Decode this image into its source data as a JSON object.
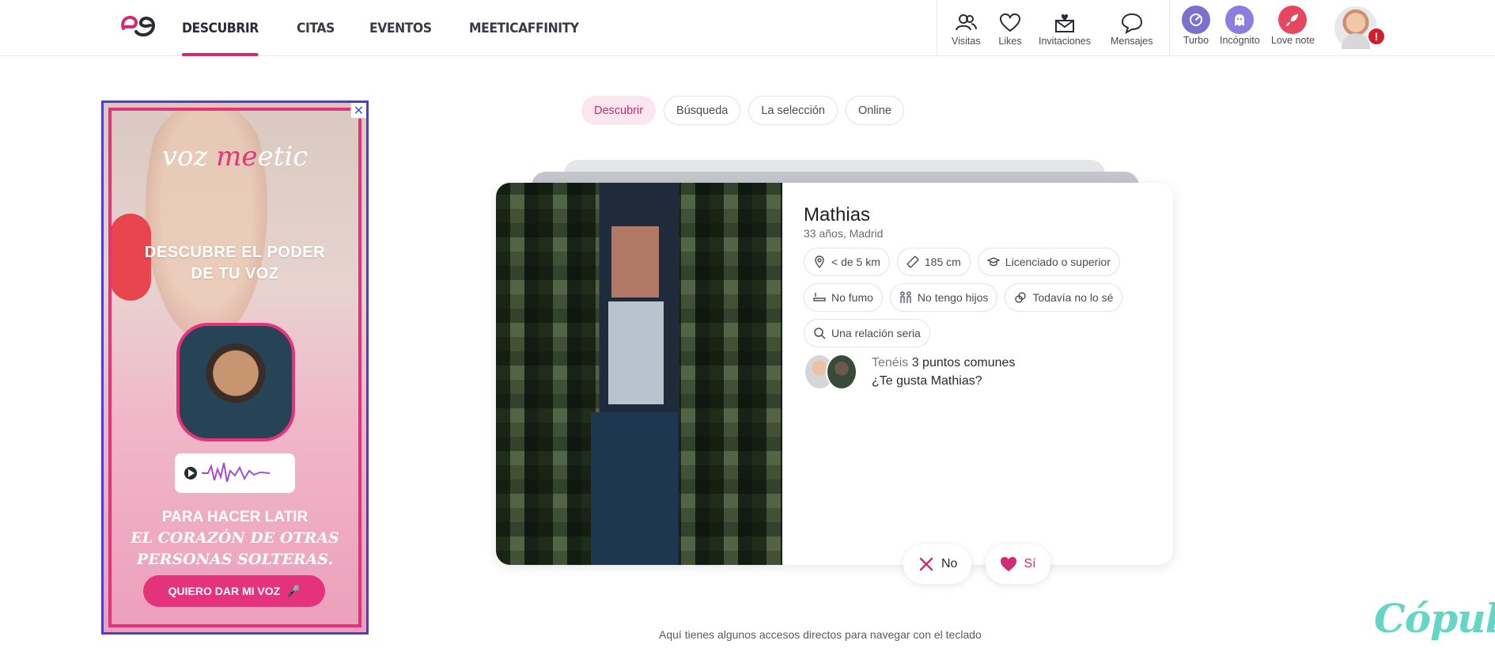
{
  "nav": {
    "items": [
      {
        "label": "DESCUBRIR",
        "active": true
      },
      {
        "label": "CITAS",
        "active": false
      },
      {
        "label": "EVENTOS",
        "active": false
      },
      {
        "label": "MEETICAFFINITY",
        "active": false
      }
    ]
  },
  "header_icons": {
    "visitas": "Visitas",
    "likes": "Likes",
    "invitaciones": "Invitaciones",
    "mensajes": "Mensajes",
    "turbo": "Turbo",
    "incognito": "Incógnito",
    "love_note": "Love note",
    "alert_mark": "!"
  },
  "ad": {
    "close": "✕",
    "brand_prefix": "voz ",
    "brand_highlight": "me",
    "brand_suffix": "etic",
    "title_line1": "DESCUBRE EL PODER",
    "title_line2": "DE TU VOZ",
    "sub_line1": "PARA HACER LATIR",
    "sub_line2": "EL CORAZÓN DE OTRAS",
    "sub_line3": "PERSONAS SOLTERAS.",
    "button": "QUIERO DAR MI VOZ"
  },
  "tabs": [
    {
      "label": "Descubrir",
      "active": true
    },
    {
      "label": "Búsqueda",
      "active": false
    },
    {
      "label": "La selección",
      "active": false
    },
    {
      "label": "Online",
      "active": false
    }
  ],
  "profile": {
    "name": "Mathias",
    "meta": "33 años, Madrid",
    "tags": {
      "distance": "< de 5 km",
      "height": "185 cm",
      "education": "Licenciado o superior",
      "smoking": "No fumo",
      "children": "No tengo hijos",
      "future": "Todavía no lo sé",
      "relationship": "Una relación seria"
    },
    "common_prefix": "Tenéis ",
    "common_count": "3 puntos comunes",
    "question": "¿Te gusta Mathias?"
  },
  "actions": {
    "no": "No",
    "yes": "Sí"
  },
  "footer": {
    "shortcuts": "Aquí tienes algunos accesos directos para navegar con el teclado"
  },
  "watermark": "Cópuli",
  "colors": {
    "accent": "#d12b73",
    "turbo": "#7b6fd0",
    "incognito": "#8c7ee0",
    "love_note": "#e8455e"
  }
}
